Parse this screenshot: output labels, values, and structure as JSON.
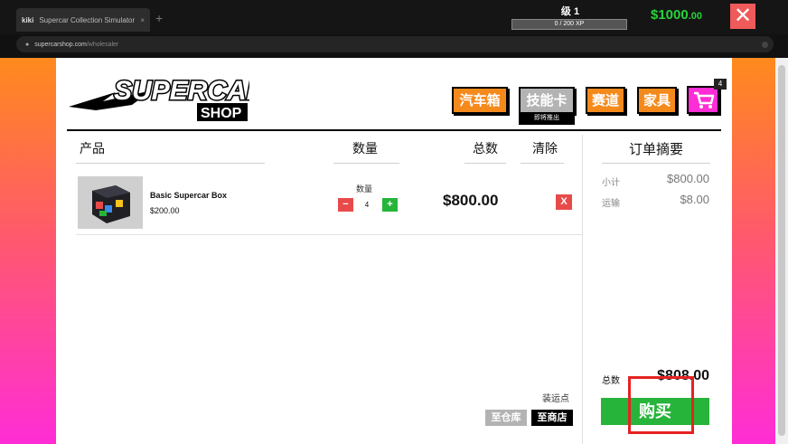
{
  "browser": {
    "tab_title": "Supercar Collection Simulator",
    "tab_site": "kiki",
    "tab_close": "×",
    "new_tab": "+",
    "url_host": "supercarshop.com",
    "url_path": "/wholesaler"
  },
  "hud": {
    "level_text": "级 1",
    "xp_text": "0 / 200 XP",
    "xp_progress": 0,
    "money_main": "$1000",
    "money_cents": ".00",
    "close_label": "✕"
  },
  "shop": {
    "logo_text": "SUPERCAR",
    "logo_sub": "SHOP",
    "nav": [
      {
        "label": "汽车箱"
      },
      {
        "label": "技能卡",
        "note": "即将推出"
      },
      {
        "label": "赛道"
      },
      {
        "label": "家具"
      }
    ],
    "cart_count": "4"
  },
  "cart": {
    "columns": {
      "product": "产品",
      "quantity": "数量",
      "total": "总数",
      "clear": "清除"
    },
    "items": [
      {
        "name": "Basic Supercar Box",
        "price": "$200.00",
        "qty_label": "数量",
        "qty": "4",
        "minus": "−",
        "plus": "+",
        "total": "$800.00",
        "remove": "X"
      }
    ]
  },
  "summary": {
    "title": "订单摘要",
    "subtotal_label": "小计",
    "subtotal": "$800.00",
    "shipping_label": "运输",
    "shipping": "$8.00",
    "total_label": "总数",
    "total": "$808.00",
    "buy_label": "购买",
    "ship_point_label": "装运点",
    "to_warehouse": "至仓库",
    "to_store": "至商店"
  },
  "colors": {
    "accent_orange": "#f58a1c",
    "buy_green": "#27b43a",
    "money_green": "#27d23a",
    "remove_red": "#e84a4a",
    "cart_pink": "#ff2dd6",
    "highlight_red": "#e62222"
  }
}
